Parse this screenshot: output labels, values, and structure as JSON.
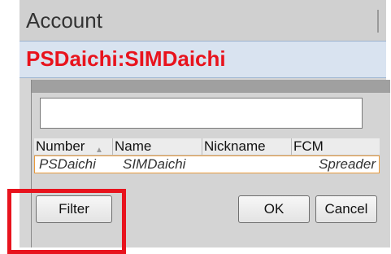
{
  "dialog": {
    "header_label": "Account",
    "selected_account": "PSDaichi:SIMDaichi"
  },
  "search": {
    "value": "",
    "placeholder": ""
  },
  "table": {
    "columns": [
      "Number",
      "Name",
      "Nickname",
      "FCM"
    ],
    "rows": [
      {
        "number": "PSDaichi",
        "name": "SIMDaichi",
        "nickname": "",
        "fcm": "Spreader"
      }
    ]
  },
  "buttons": {
    "filter": "Filter",
    "ok": "OK",
    "cancel": "Cancel"
  },
  "colors": {
    "selected_text": "#e8131d",
    "annotation": "#e8131d",
    "row_highlight": "#e89a3c"
  }
}
